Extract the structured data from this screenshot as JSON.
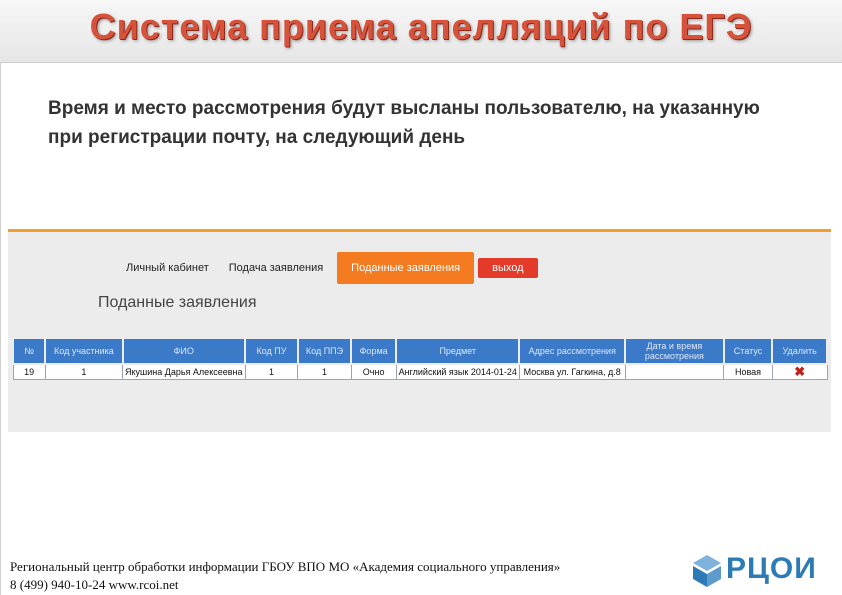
{
  "header": {
    "title": "Система приема апелляций по ЕГЭ"
  },
  "intro": "Время и место рассмотрения будут высланы пользователю, на указанную при регистрации почту, на следующий день",
  "app": {
    "tabs": [
      "Личный кабинет",
      "Подача заявления",
      "Поданные заявления"
    ],
    "logout_label": "выход",
    "section_title": "Поданные заявления",
    "table": {
      "headers": [
        "№",
        "Код участника",
        "ФИО",
        "Код ПУ",
        "Код ППЭ",
        "Форма",
        "Предмет",
        "Адрес рассмотрения",
        "Дата и время рассмотрения",
        "Статус",
        "Удалить"
      ],
      "rows": [
        {
          "num": "19",
          "participant_code": "1",
          "fio": "Якушина Дарья Алексеевна",
          "pu_code": "1",
          "ppe_code": "1",
          "form": "Очно",
          "subject": "Английский язык 2014-01-24",
          "address": "Москва ул. Гагкина, д.8",
          "datetime": "",
          "status": "Новая",
          "delete_icon": "delete-x-icon"
        }
      ]
    }
  },
  "footer": {
    "line1": "Региональный центр обработки информации ГБОУ ВПО МО «Академия социального управления»",
    "line2": "8 (499) 940-10-24 www.rcoi.net",
    "logo_text": "РЦОИ"
  },
  "colors": {
    "title": "#d6523b",
    "accent_tab": "#f47b20",
    "logout": "#e33a2a",
    "table_header": "#3b79c9",
    "logo": "#2d7bb6"
  }
}
